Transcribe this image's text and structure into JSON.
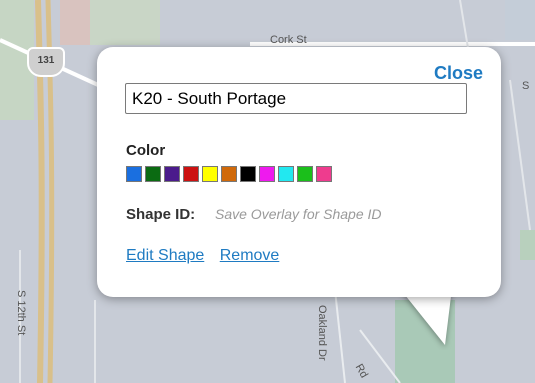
{
  "map": {
    "shield_number": "131",
    "road_labels": {
      "top_road": "Cork St",
      "top_right": "S",
      "bottom_road_1": "Oakland Dr",
      "bottom_road_2": "Rd",
      "left_road": "S 12th St"
    }
  },
  "popup": {
    "close_label": "Close",
    "name_value": "K20 - South Portage",
    "color_label": "Color",
    "swatches": [
      "#1a6fe0",
      "#0b6b12",
      "#4b1b8c",
      "#cc1111",
      "#ffff00",
      "#d0690a",
      "#000000",
      "#ee1aee",
      "#22e8f0",
      "#1bbf1b",
      "#ee3c8e"
    ],
    "shape_id_label": "Shape ID:",
    "shape_id_value": "Save Overlay for Shape ID",
    "edit_shape_label": "Edit Shape",
    "remove_label": "Remove"
  }
}
